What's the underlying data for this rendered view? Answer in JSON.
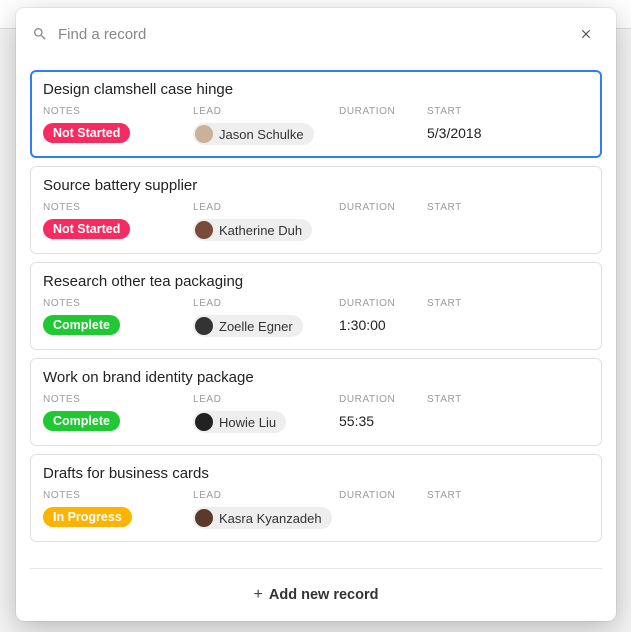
{
  "search": {
    "placeholder": "Find a record"
  },
  "column_headers": {
    "notes": "NOTES",
    "lead": "LEAD",
    "duration": "DURATION",
    "start": "START"
  },
  "records": [
    {
      "title": "Design clamshell case hinge",
      "status_label": "Not Started",
      "status_color": "#f82b60",
      "lead_name": "Jason Schulke",
      "avatar_color": "#c9b29a",
      "duration": "",
      "start": "5/3/2018",
      "selected": true
    },
    {
      "title": "Source battery supplier",
      "status_label": "Not Started",
      "status_color": "#f82b60",
      "lead_name": "Katherine Duh",
      "avatar_color": "#7a4a3a",
      "duration": "",
      "start": "",
      "selected": false
    },
    {
      "title": "Research other tea packaging",
      "status_label": "Complete",
      "status_color": "#20c933",
      "lead_name": "Zoelle Egner",
      "avatar_color": "#333333",
      "duration": "1:30:00",
      "start": "",
      "selected": false
    },
    {
      "title": "Work on brand identity package",
      "status_label": "Complete",
      "status_color": "#20c933",
      "lead_name": "Howie Liu",
      "avatar_color": "#222222",
      "duration": "55:35",
      "start": "",
      "selected": false
    },
    {
      "title": "Drafts for business cards",
      "status_label": "In Progress",
      "status_color": "#fcb400",
      "lead_name": "Kasra Kyanzadeh",
      "avatar_color": "#5a3a2a",
      "duration": "",
      "start": "",
      "selected": false
    }
  ],
  "footer": {
    "plus": "+",
    "label": "Add new record"
  }
}
